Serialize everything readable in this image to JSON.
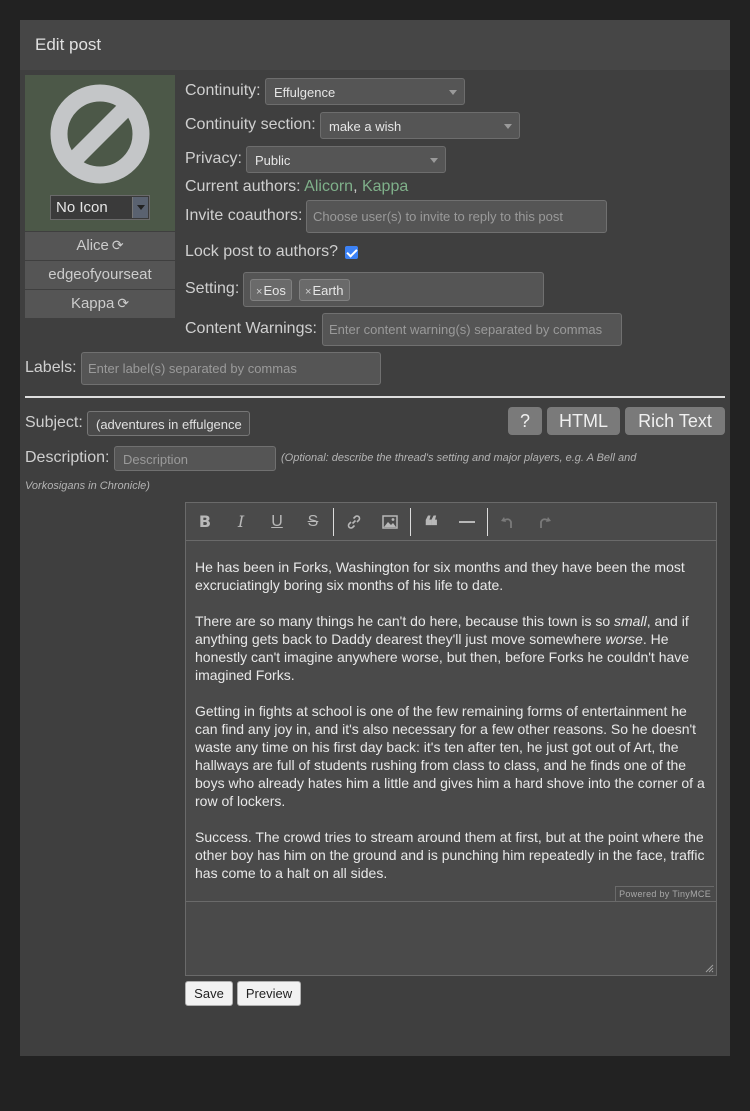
{
  "header": {
    "title": "Edit post"
  },
  "icon_panel": {
    "icon_select": "No Icon",
    "characters": [
      {
        "label": "Alice",
        "swap_icon": "refresh-icon"
      },
      {
        "label": "edgeofyourseat"
      },
      {
        "label": "Kappa",
        "swap_icon": "refresh-icon"
      }
    ]
  },
  "form": {
    "continuity_label": "Continuity:",
    "continuity_value": "Effulgence",
    "section_label": "Continuity section:",
    "section_value": "make a wish",
    "privacy_label": "Privacy:",
    "privacy_value": "Public",
    "authors_label": "Current authors:",
    "authors": [
      "Alicorn",
      "Kappa"
    ],
    "authors_sep": ",",
    "invite_label": "Invite coauthors:",
    "invite_placeholder": "Choose user(s) to invite to reply to this post",
    "lock_label": "Lock post to authors?",
    "lock_checked": true,
    "setting_label": "Setting:",
    "setting_tags": [
      "Eos",
      "Earth"
    ],
    "tag_remove": "×",
    "warnings_label": "Content Warnings:",
    "warnings_placeholder": "Enter content warning(s) separated by commas",
    "labels_label": "Labels:",
    "labels_placeholder": "Enter label(s) separated by commas",
    "subject_label": "Subject:",
    "subject_value": "(adventures in effulgence",
    "description_label": "Description:",
    "description_placeholder": "Description",
    "description_hint_1": "(Optional: describe the thread's setting and major players, e.g. A Bell and",
    "description_hint_2": "Vorkosigans in Chronicle)"
  },
  "editor_modes": {
    "help": "?",
    "html": "HTML",
    "rich": "Rich Text"
  },
  "toolbar": {
    "bold": "B",
    "italic": "I",
    "underline": "U",
    "strike": "S",
    "icons": [
      "bold-icon",
      "italic-icon",
      "underline-icon",
      "strikethrough-icon",
      "link-icon",
      "image-icon",
      "blockquote-icon",
      "horizontal-rule-icon",
      "undo-icon",
      "redo-icon"
    ]
  },
  "editor": {
    "p1": "He has been in Forks, Washington for six months and they have been the most excruciatingly boring six months of his life to date.",
    "p2a": "There are so many things he can't do here, because this town is so ",
    "p2_em1": "small",
    "p2b": ", and if anything gets back to Daddy dearest they'll just move somewhere ",
    "p2_em2": "worse",
    "p2c": ". He honestly can't imagine anywhere worse, but then, before Forks he couldn't have imagined Forks.",
    "p3": "Getting in fights at school is one of the few remaining forms of entertainment he can find any joy in, and it's also necessary for a few other reasons. So he doesn't waste any time on his first day back: it's ten after ten, he just got out of Art, the hallways are full of students rushing from class to class, and he finds one of the boys who already hates him a little and gives him a hard shove into the corner of a row of lockers.",
    "p4": "Success. The crowd tries to stream around them at first, but at the point where the other boy has him on the ground and is punching him repeatedly in the face, traffic has come to a halt on all sides.",
    "powered_by": "Powered by TinyMCE"
  },
  "actions": {
    "save": "Save",
    "preview": "Preview"
  }
}
